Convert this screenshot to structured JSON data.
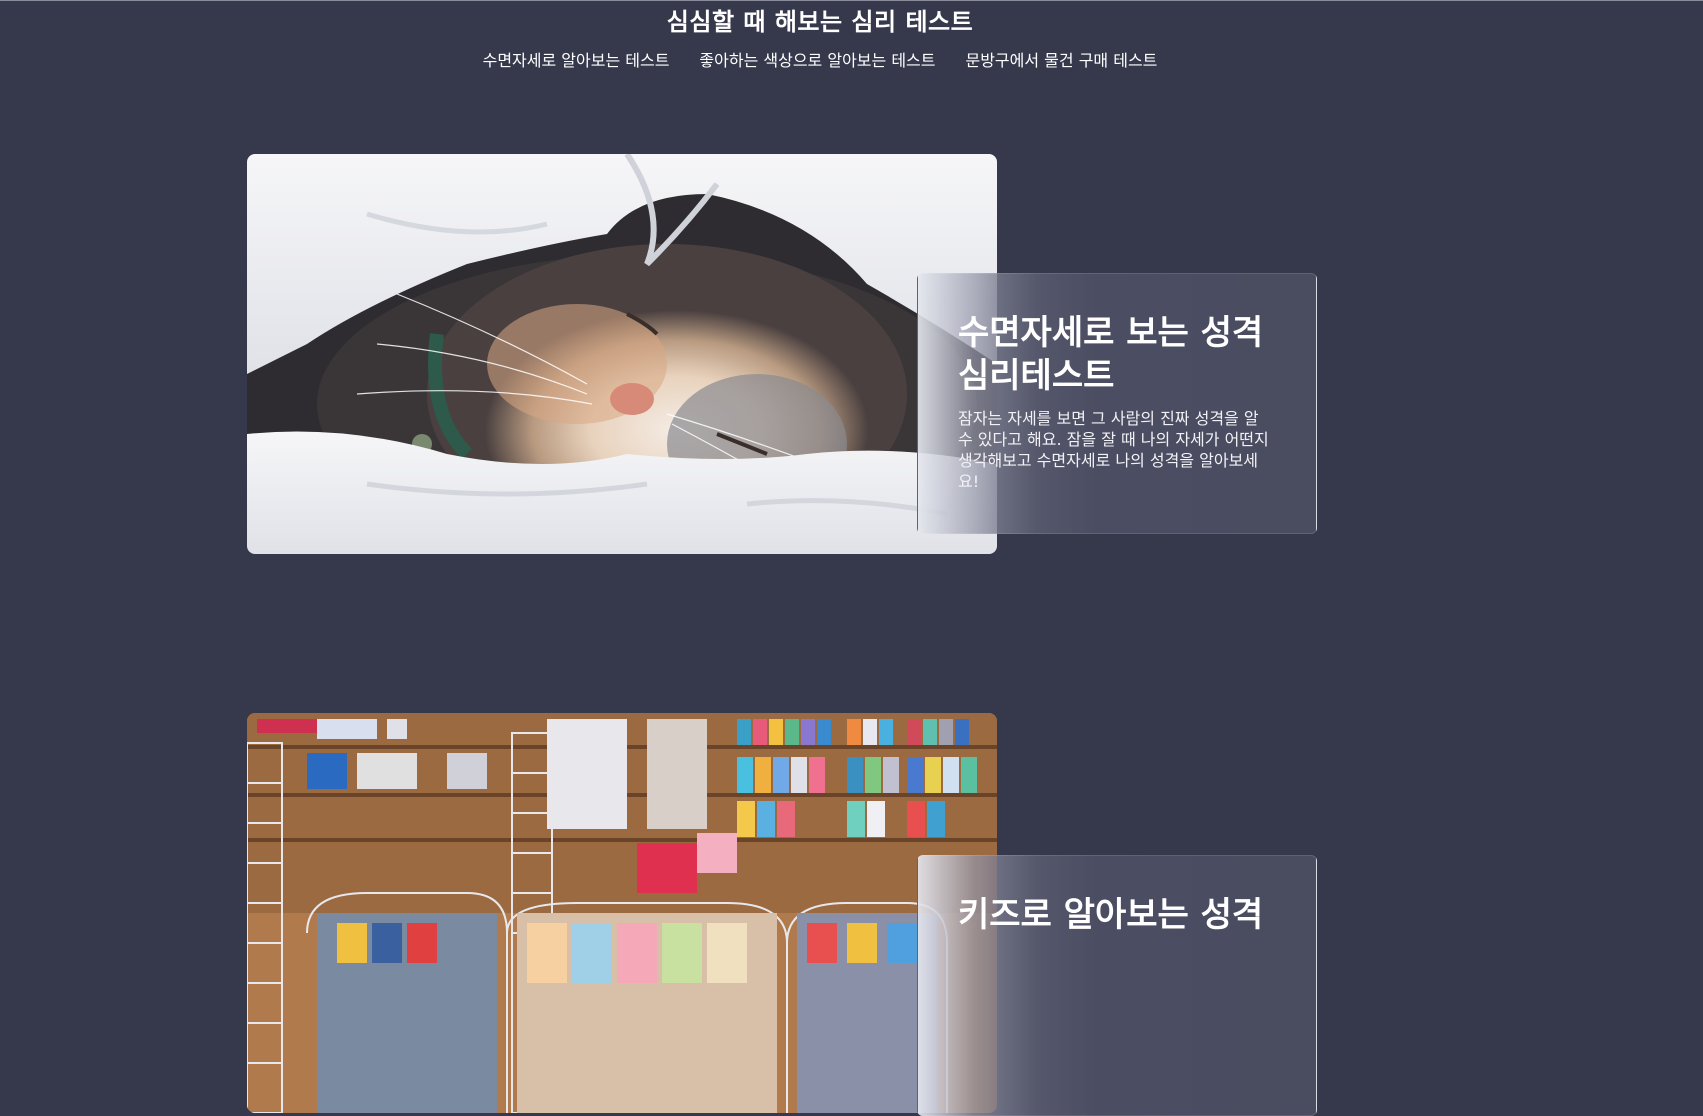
{
  "header": {
    "title": "심심할 때 해보는 심리 테스트",
    "nav": [
      "수면자세로 알아보는 테스트",
      "좋아하는 색상으로 알아보는 테스트",
      "문방구에서 물건 구매 테스트"
    ]
  },
  "cards": [
    {
      "title": "수면자세로 보는 성격 심리테스트",
      "description": "잠자는 자세를 보면 그 사람의 진짜 성격을 알 수 있다고 해요. 잠을 잘 때 나의 자세가 어떤지 생각해보고 수면자세로 나의 성격을 알아보세요!",
      "image_alt": "sleeping-cat-under-blanket"
    },
    {
      "title": "키즈로 알아보는 성격",
      "image_alt": "stationery-store"
    }
  ],
  "colors": {
    "background": "#36384c",
    "card_panel": "#4a4c60",
    "text": "#ffffff"
  }
}
